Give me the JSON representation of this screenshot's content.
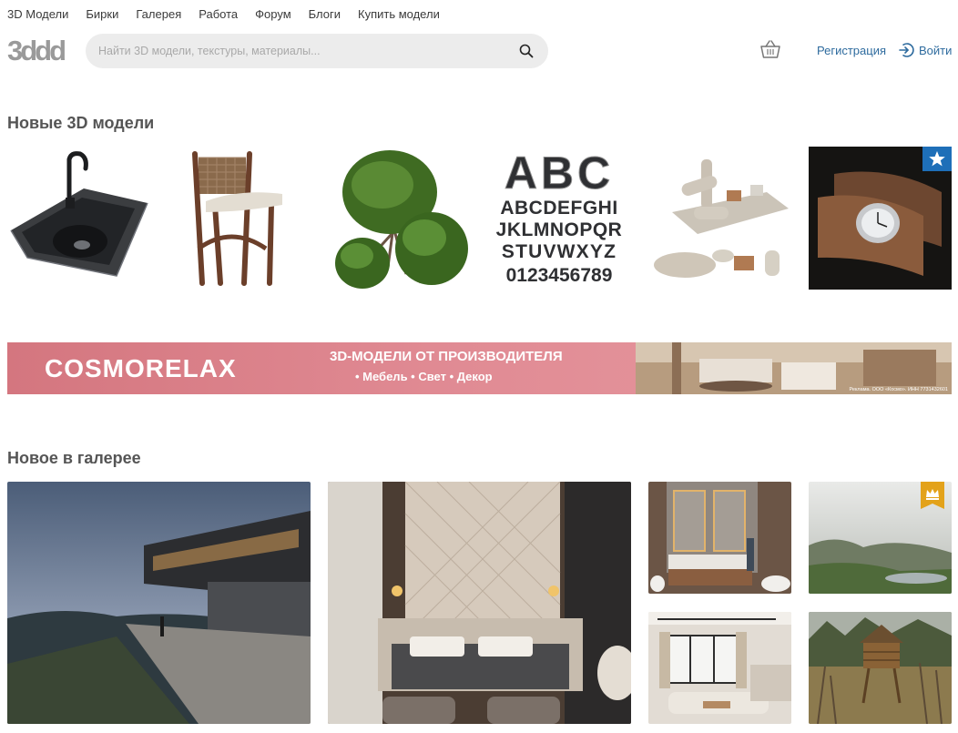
{
  "nav": [
    "3D Модели",
    "Бирки",
    "Галерея",
    "Работа",
    "Форум",
    "Блоги",
    "Купить модели"
  ],
  "logo_text": "3ddd",
  "search": {
    "placeholder": "Найти 3D модели, текстуры, материалы..."
  },
  "account": {
    "register": "Регистрация",
    "login": "Войти"
  },
  "sections": {
    "new_models": "Новые 3D модели",
    "gallery": "Новое в галерее"
  },
  "models": [
    {
      "name": "sink"
    },
    {
      "name": "bar-stool"
    },
    {
      "name": "topiary-tree"
    },
    {
      "name": "marquee-letters",
      "lines": [
        "ABC",
        "ABCDEFGHI",
        "JKLMNOPQR",
        "STUVWXYZ",
        "0123456789"
      ]
    },
    {
      "name": "yoga-mats"
    },
    {
      "name": "watch-case",
      "badge": "pro-star-icon"
    }
  ],
  "banner": {
    "brand": "COSMORELAX",
    "headline": "3D-МОДЕЛИ ОТ ПРОИЗВОДИТЕЛЯ",
    "bullets": "• Мебель   • Свет   • Декор",
    "ad_note": "Реклама. ООО «Космо». ИНН 7731432601"
  },
  "gallery": [
    {
      "name": "modern-villa-dusk"
    },
    {
      "name": "bedroom-interior"
    },
    {
      "name": "bathroom-marble"
    },
    {
      "name": "foggy-valley",
      "badge": "crown-icon"
    },
    {
      "name": "living-room"
    },
    {
      "name": "wooden-hut"
    }
  ],
  "colors": {
    "link": "#2e6b9e",
    "badge_blue": "#1e6fb8",
    "badge_gold": "#e3a21a",
    "banner_pink": "#e08a93"
  }
}
